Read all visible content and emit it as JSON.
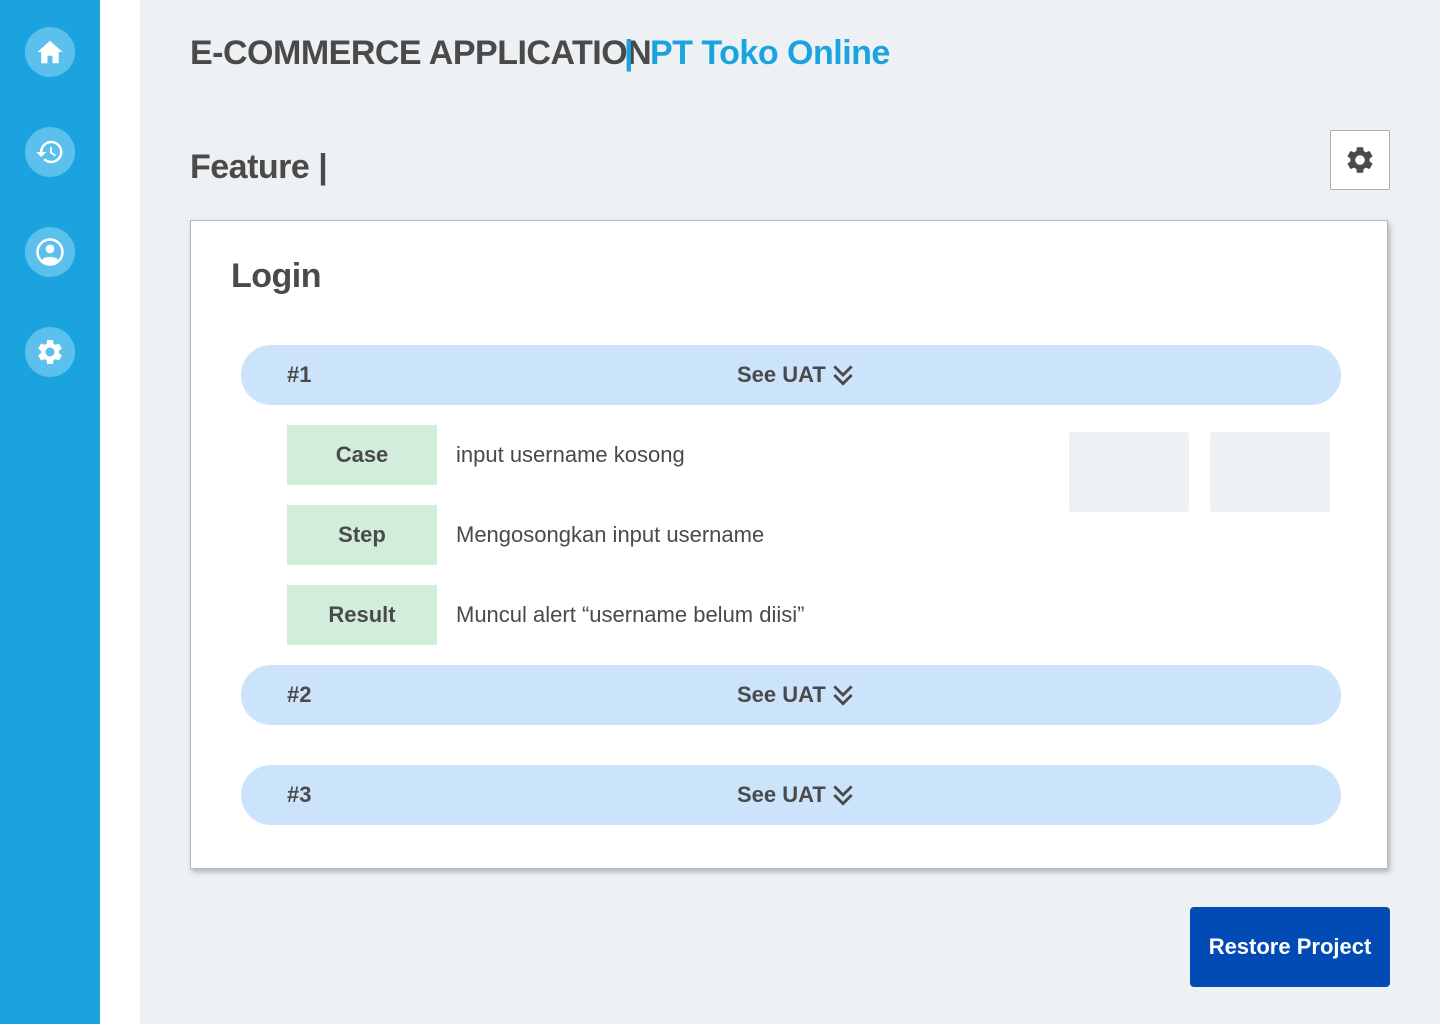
{
  "sidebar": {
    "items": [
      {
        "icon": "home-icon"
      },
      {
        "icon": "history-icon"
      },
      {
        "icon": "user-icon"
      },
      {
        "icon": "gear-icon"
      }
    ]
  },
  "header": {
    "app_title": "E-COMMERCE APPLICATION",
    "separator": "|",
    "company": "PT Toko Online"
  },
  "feature": {
    "title": "Feature |",
    "settings_icon": "gear-icon"
  },
  "card": {
    "title": "Login",
    "uats": [
      {
        "number": "#1",
        "see_label": "See UAT",
        "expanded": true,
        "details": [
          {
            "label": "Case",
            "value": "input username kosong"
          },
          {
            "label": "Step",
            "value": "Mengosongkan input username"
          },
          {
            "label": "Result",
            "value": "Muncul alert “username belum diisi”"
          }
        ]
      },
      {
        "number": "#2",
        "see_label": "See UAT",
        "expanded": false
      },
      {
        "number": "#3",
        "see_label": "See UAT",
        "expanded": false
      }
    ]
  },
  "actions": {
    "restore_label": "Restore Project"
  },
  "colors": {
    "sidebar": "#1ba3e0",
    "accent": "#1ba3e0",
    "uat_row": "#cbe3fb",
    "detail_label": "#d3eddc",
    "primary_button": "#034bb4",
    "text": "#4a4a4a"
  }
}
